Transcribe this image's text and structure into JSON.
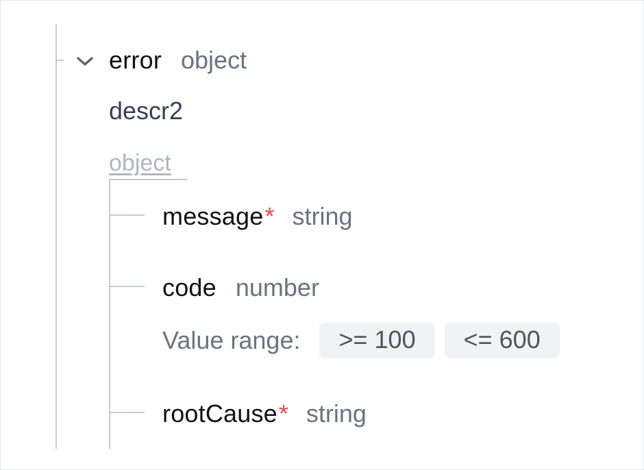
{
  "schema": {
    "root": {
      "name": "error",
      "type": "object",
      "description": "descr2",
      "object_link": "object",
      "expanded": true
    },
    "children": [
      {
        "name": "message",
        "required_mark": "*",
        "type": "string"
      },
      {
        "name": "code",
        "type": "number",
        "range_label": "Value range:",
        "range_min": ">= 100",
        "range_max": "<= 600"
      },
      {
        "name": "rootCause",
        "required_mark": "*",
        "type": "string"
      }
    ]
  },
  "icons": {
    "expand": "chevron-down-icon"
  },
  "colors": {
    "name": "#111111",
    "type": "#6b7280",
    "required": "#e5484d",
    "rail": "#c7cbd3",
    "chip_bg": "#f1f2f4",
    "link": "#b0b6c1"
  }
}
